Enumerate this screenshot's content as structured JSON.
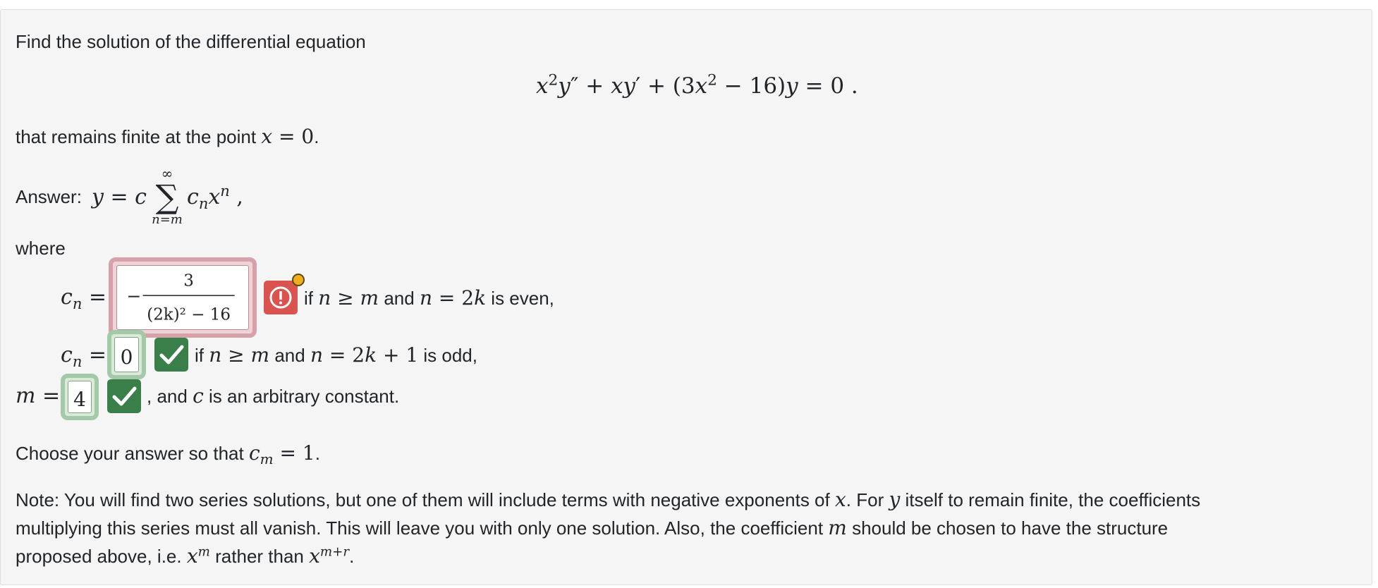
{
  "problem": {
    "intro": "Find the solution of the differential equation",
    "equation": "x²y″ + xy′ + (3x² − 16)y = 0 .",
    "finite_prefix": "that remains finite at the point",
    "finite_math": "x = 0",
    "finite_suffix": "."
  },
  "answer": {
    "label": "Answer:",
    "lhs": "y = c",
    "sum_upper": "∞",
    "sum_lower": "n=m",
    "term": "cₙxⁿ",
    "term_suffix": ",",
    "where": "where",
    "cn_label": "cₙ =",
    "cn_even_input": {
      "sign": "−",
      "numerator": "3",
      "denominator": "(2k)² − 16",
      "status": "incorrect"
    },
    "cn_even_cond_1": "if",
    "cn_even_cond_math_1": "n ≥ m",
    "cn_even_cond_2": "and",
    "cn_even_cond_math_2": "n = 2k",
    "cn_even_cond_3": "is even,",
    "cn_odd_input": {
      "value": "0",
      "status": "correct"
    },
    "cn_odd_cond_1": "if",
    "cn_odd_cond_math_1": "n ≥ m",
    "cn_odd_cond_2": "and",
    "cn_odd_cond_math_2": "n = 2k + 1",
    "cn_odd_cond_3": "is odd,",
    "m_label": "m =",
    "m_input": {
      "value": "4",
      "status": "correct"
    },
    "m_suffix_1": ", and",
    "m_suffix_math": "c",
    "m_suffix_2": "is an arbitrary constant."
  },
  "choose": {
    "prefix": "Choose your answer so that",
    "math": "cₘ = 1",
    "suffix": "."
  },
  "note": {
    "line1_a": "Note: You will find two series solutions, but one of them will include terms with negative exponents of",
    "line1_x": "x",
    "line1_b": ". For",
    "line1_y": "y",
    "line1_c": "itself to remain finite, the coefficients",
    "line2_a": "multiplying this series must all vanish. This will leave you with only one solution. Also, the coefficient",
    "line2_m": "m",
    "line2_b": "should be chosen to have the structure",
    "line3_a": "proposed above, i.e.",
    "line3_xm": "xᵐ",
    "line3_b": "rather than",
    "line3_xmr": "xᵐ⁺ʳ",
    "line3_c": "."
  },
  "colors": {
    "incorrect": "#d9534f",
    "correct": "#3a7f4a",
    "warning_dot": "#f0ad1e"
  },
  "icons": {
    "incorrect": "exclamation-circle-icon",
    "correct": "checkmark-icon"
  }
}
